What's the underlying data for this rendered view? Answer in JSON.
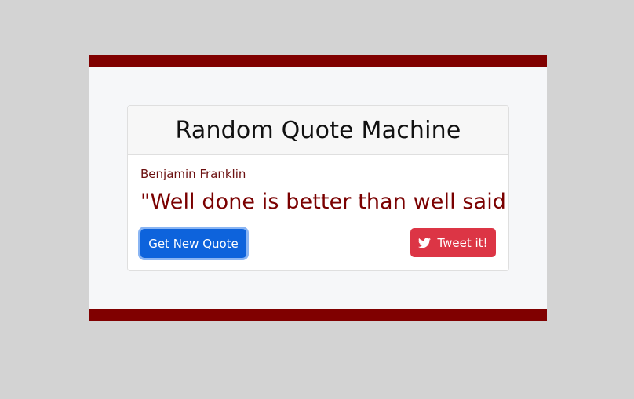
{
  "app": {
    "title": "Random Quote Machine"
  },
  "quote": {
    "author": "Benjamin Franklin",
    "text": "\"Well done is better than well said.\""
  },
  "buttons": {
    "new_quote_label": "Get New Quote",
    "tweet_label": "Tweet it!"
  },
  "icons": {
    "tweet": "twitter-icon"
  },
  "colors": {
    "page_background": "#d3d3d3",
    "frame_border": "#800000",
    "quote_text": "#7a0000",
    "primary_button": "#0d63dc",
    "tweet_button": "#dc3545"
  }
}
